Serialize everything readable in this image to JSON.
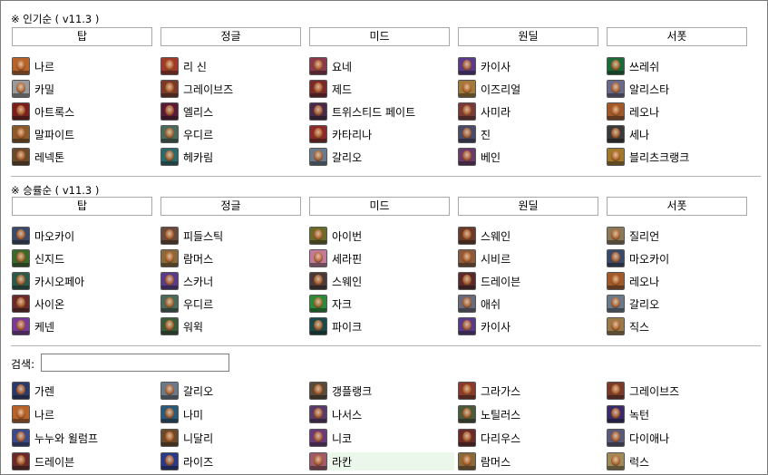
{
  "popular": {
    "title": "※ 인기순 ( v11.3 )",
    "lanes": [
      "탑",
      "정글",
      "미드",
      "원딜",
      "서폿"
    ],
    "columns": [
      [
        {
          "name": "나르",
          "color": "#b8632a"
        },
        {
          "name": "카밀",
          "color": "#9a9a9a"
        },
        {
          "name": "아트록스",
          "color": "#7a1e1e"
        },
        {
          "name": "말파이트",
          "color": "#8a5a2a"
        },
        {
          "name": "레넥톤",
          "color": "#6a4a2a"
        }
      ],
      [
        {
          "name": "리 신",
          "color": "#a03a2a"
        },
        {
          "name": "그레이브즈",
          "color": "#7a3a2a"
        },
        {
          "name": "엘리스",
          "color": "#5a1a3a"
        },
        {
          "name": "우디르",
          "color": "#4a6a5a"
        },
        {
          "name": "헤카림",
          "color": "#2a6a6a"
        }
      ],
      [
        {
          "name": "요네",
          "color": "#8a3a4a"
        },
        {
          "name": "제드",
          "color": "#7a2a2a"
        },
        {
          "name": "트위스티드 페이트",
          "color": "#4a2a4a"
        },
        {
          "name": "카타리나",
          "color": "#8a2a2a"
        },
        {
          "name": "갈리오",
          "color": "#6a7a8a"
        }
      ],
      [
        {
          "name": "카이사",
          "color": "#5a3a8a"
        },
        {
          "name": "이즈리얼",
          "color": "#a07a3a"
        },
        {
          "name": "사미라",
          "color": "#7a3a3a"
        },
        {
          "name": "진",
          "color": "#4a4a6a"
        },
        {
          "name": "베인",
          "color": "#6a3a6a"
        }
      ],
      [
        {
          "name": "쓰레쉬",
          "color": "#1a6a3a"
        },
        {
          "name": "알리스타",
          "color": "#6a6a8a"
        },
        {
          "name": "레오나",
          "color": "#a05a2a"
        },
        {
          "name": "세나",
          "color": "#3a3a3a"
        },
        {
          "name": "블리츠크랭크",
          "color": "#a07a2a"
        }
      ]
    ]
  },
  "winrate": {
    "title": "※ 승률순 ( v11.3 )",
    "lanes": [
      "탑",
      "정글",
      "미드",
      "원딜",
      "서폿"
    ],
    "columns": [
      [
        {
          "name": "마오카이",
          "color": "#3a4a6a"
        },
        {
          "name": "신지드",
          "color": "#3a6a2a"
        },
        {
          "name": "카시오페아",
          "color": "#2a5a4a"
        },
        {
          "name": "사이온",
          "color": "#6a2a2a"
        },
        {
          "name": "케넨",
          "color": "#7a3a9a"
        }
      ],
      [
        {
          "name": "피들스틱",
          "color": "#6a4a3a"
        },
        {
          "name": "람머스",
          "color": "#8a6a3a"
        },
        {
          "name": "스카너",
          "color": "#5a3a8a"
        },
        {
          "name": "우디르",
          "color": "#4a6a5a"
        },
        {
          "name": "워윅",
          "color": "#3a5a3a"
        }
      ],
      [
        {
          "name": "아이번",
          "color": "#6a6a2a"
        },
        {
          "name": "세라핀",
          "color": "#c07a9a"
        },
        {
          "name": "스웨인",
          "color": "#4a3a3a"
        },
        {
          "name": "자크",
          "color": "#2a8a3a"
        },
        {
          "name": "파이크",
          "color": "#1a4a4a"
        }
      ],
      [
        {
          "name": "스웨인",
          "color": "#6a3a2a"
        },
        {
          "name": "시비르",
          "color": "#8a5a3a"
        },
        {
          "name": "드레이븐",
          "color": "#5a2a2a"
        },
        {
          "name": "애쉬",
          "color": "#6a6a7a"
        },
        {
          "name": "카이사",
          "color": "#5a3a8a"
        }
      ],
      [
        {
          "name": "질리언",
          "color": "#8a7a5a"
        },
        {
          "name": "마오카이",
          "color": "#3a4a6a"
        },
        {
          "name": "레오나",
          "color": "#a05a2a"
        },
        {
          "name": "갈리오",
          "color": "#6a7a8a"
        },
        {
          "name": "직스",
          "color": "#9a7a4a"
        }
      ]
    ]
  },
  "search": {
    "label": "검색:",
    "value": "",
    "placeholder": ""
  },
  "all_champions": {
    "columns": [
      [
        {
          "name": "가렌",
          "color": "#2a3a6a"
        },
        {
          "name": "나르",
          "color": "#b8632a"
        },
        {
          "name": "누누와 윌럼프",
          "color": "#3a4a8a"
        },
        {
          "name": "드레이븐",
          "color": "#6a2a2a"
        }
      ],
      [
        {
          "name": "갈리오",
          "color": "#6a7a8a"
        },
        {
          "name": "나미",
          "color": "#2a5a7a"
        },
        {
          "name": "니달리",
          "color": "#6a4a2a"
        },
        {
          "name": "라이즈",
          "color": "#2a3a8a"
        }
      ],
      [
        {
          "name": "갱플랭크",
          "color": "#5a4a3a"
        },
        {
          "name": "나서스",
          "color": "#5a3a6a"
        },
        {
          "name": "니코",
          "color": "#6a3a7a"
        },
        {
          "name": "라칸",
          "color": "#a05a6a",
          "highlight": true
        }
      ],
      [
        {
          "name": "그라가스",
          "color": "#8a3a2a"
        },
        {
          "name": "노틸러스",
          "color": "#4a5a3a"
        },
        {
          "name": "다리우스",
          "color": "#6a2a2a"
        },
        {
          "name": "람머스",
          "color": "#8a6a3a"
        }
      ],
      [
        {
          "name": "그레이브즈",
          "color": "#7a3a2a"
        },
        {
          "name": "녹턴",
          "color": "#3a2a6a"
        },
        {
          "name": "다이애나",
          "color": "#5a5a7a"
        },
        {
          "name": "럭스",
          "color": "#a08a5a"
        }
      ]
    ]
  },
  "colors": {
    "border": "#7a7a7a",
    "button_border": "#a8a8a8",
    "divider": "#b5b5b5",
    "row_highlight": "#eaf7ea"
  }
}
